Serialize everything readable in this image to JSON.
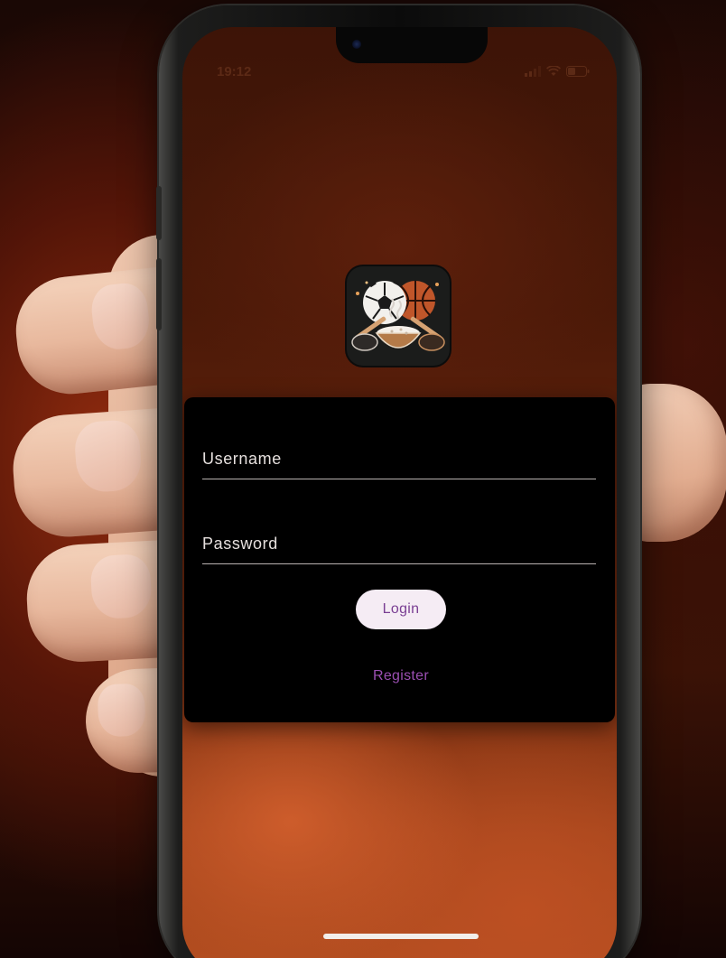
{
  "status_bar": {
    "time": "19:12"
  },
  "app": {
    "logo_icon": "sports-food-logo-icon"
  },
  "login_form": {
    "username_placeholder": "Username",
    "username_value": "",
    "password_placeholder": "Password",
    "password_value": "",
    "login_label": "Login",
    "register_label": "Register"
  },
  "colors": {
    "card_background": "#000000",
    "login_button_bg": "#f5ecf4",
    "login_button_text": "#7a3f93",
    "register_link": "#9b4fb2",
    "screen_background": "#6a260d"
  }
}
